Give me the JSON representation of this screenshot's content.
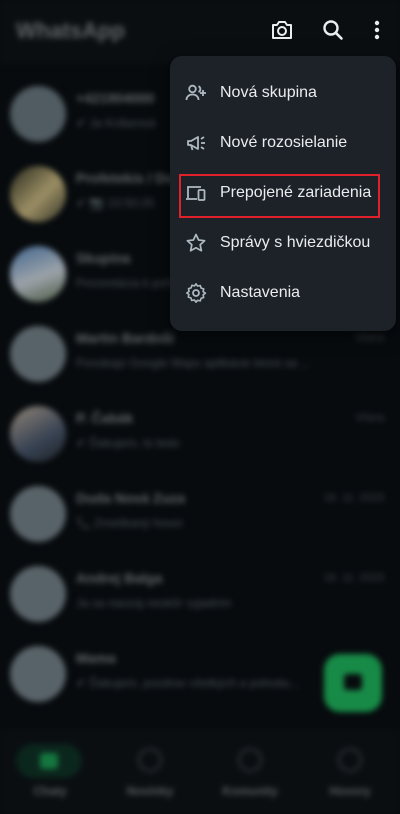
{
  "app": {
    "title": "WhatsApp"
  },
  "chats": [
    {
      "name": "+421904000",
      "snippet": "✔ Ja Kollarová",
      "time": "",
      "avatar": "default"
    },
    {
      "name": "Profetekis / Domov",
      "snippet": "✔ 📷 10:50:25",
      "time": "",
      "avatar": "photo"
    },
    {
      "name": "Skupina",
      "snippet": "Prezentácia k pohovoru",
      "time": "",
      "avatar": "photo"
    },
    {
      "name": "Martin Bardoši",
      "snippet": "Ponúkajú Google Maps aplikácie ktorá sa ...",
      "time": "Včera",
      "avatar": "default"
    },
    {
      "name": "P. Čabák",
      "snippet": "✔ Ďakujem, to bolo",
      "time": "Včera",
      "avatar": "photo"
    },
    {
      "name": "Duda Nová Zuza",
      "snippet": "📞 Zmeškaný hovor",
      "time": "16. 11. 2023",
      "avatar": "default"
    },
    {
      "name": "Andrej Balga",
      "snippet": "Ja sa naozaj neskôr vyjadrím",
      "time": "16. 11. 2023",
      "avatar": "default"
    },
    {
      "name": "Mama",
      "snippet": "✔ Ďakujem, pozdrav všetkých a pohodu...",
      "time": "",
      "avatar": "default"
    }
  ],
  "bottom_nav": [
    {
      "label": "Chaty",
      "active": true
    },
    {
      "label": "Novinky",
      "active": false
    },
    {
      "label": "Komunity",
      "active": false
    },
    {
      "label": "Hovory",
      "active": false
    }
  ],
  "menu": {
    "items": [
      {
        "label": "Nová skupina",
        "icon": "add-group-icon"
      },
      {
        "label": "Nové rozosielanie",
        "icon": "megaphone-icon"
      },
      {
        "label": "Prepojené zariadenia",
        "icon": "linked-devices-icon",
        "highlighted": true
      },
      {
        "label": "Správy s hviezdičkou",
        "icon": "star-icon"
      },
      {
        "label": "Nastavenia",
        "icon": "gear-icon"
      }
    ]
  },
  "colors": {
    "background": "#0b1014",
    "menu": "#1d2228",
    "accent": "#21c063",
    "highlight": "#e0212b",
    "text": "#e9edef"
  }
}
